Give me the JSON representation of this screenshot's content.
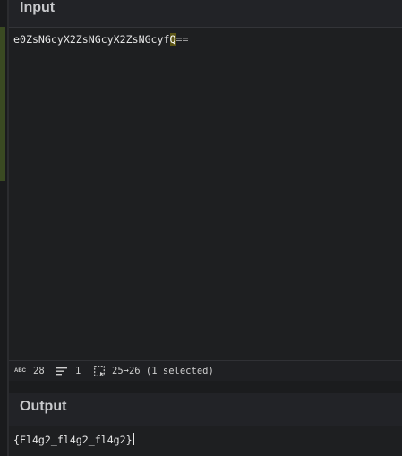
{
  "input": {
    "title": "Input",
    "text_before": "e0ZsNGcyX2ZsNGcyX2ZsNGcyf",
    "text_selected": "Q",
    "text_after": "=="
  },
  "status": {
    "chars_icon": "abc-icon",
    "chars": "28",
    "lines_icon": "lines-icon",
    "lines": "1",
    "selection_icon": "selection-icon",
    "selection": "25➞26 (1 selected)"
  },
  "output": {
    "title": "Output",
    "text": "{Fl4g2_fl4g2_fl4g2}"
  },
  "colors": {
    "background": "#1e1f21",
    "header": "#222327",
    "highlight": "#5a5314",
    "gutter_accent": "#3a4a22"
  }
}
